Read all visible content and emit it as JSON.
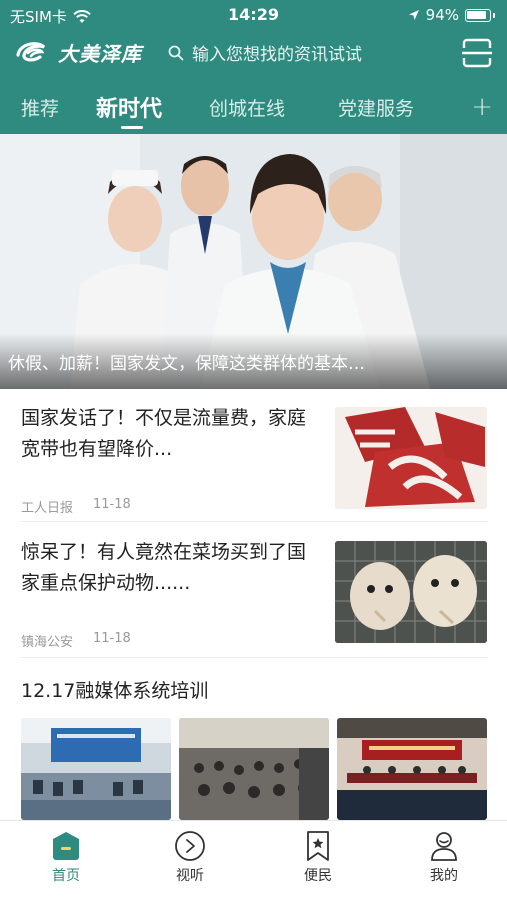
{
  "status_bar": {
    "carrier": "无SIM卡",
    "time": "14:29",
    "battery": "94%"
  },
  "header": {
    "logo_text": "大美泽库",
    "search_placeholder": "输入您想找的资讯试试",
    "accent_color": "#2f8a80"
  },
  "tabs": [
    {
      "label": "推荐"
    },
    {
      "label": "新时代"
    },
    {
      "label": "创城在线"
    },
    {
      "label": "党建服务"
    }
  ],
  "tab_add_label": "+",
  "banner": {
    "caption": "休假、加薪！国家发文，保障这类群体的基本…"
  },
  "news": [
    {
      "title": "国家发话了！不仅是流量费，家庭宽带也有望降价...",
      "source": "工人日报",
      "date": "11-18"
    },
    {
      "title": "惊呆了！有人竟然在菜场买到了国家重点保护动物......",
      "source": "镇海公安",
      "date": "11-18"
    }
  ],
  "section": {
    "title": "12.17融媒体系统培训"
  },
  "bottom_nav": [
    {
      "label": "首页",
      "icon": "home-icon"
    },
    {
      "label": "视听",
      "icon": "play-icon"
    },
    {
      "label": "便民",
      "icon": "bookmark-star-icon"
    },
    {
      "label": "我的",
      "icon": "user-icon"
    }
  ]
}
